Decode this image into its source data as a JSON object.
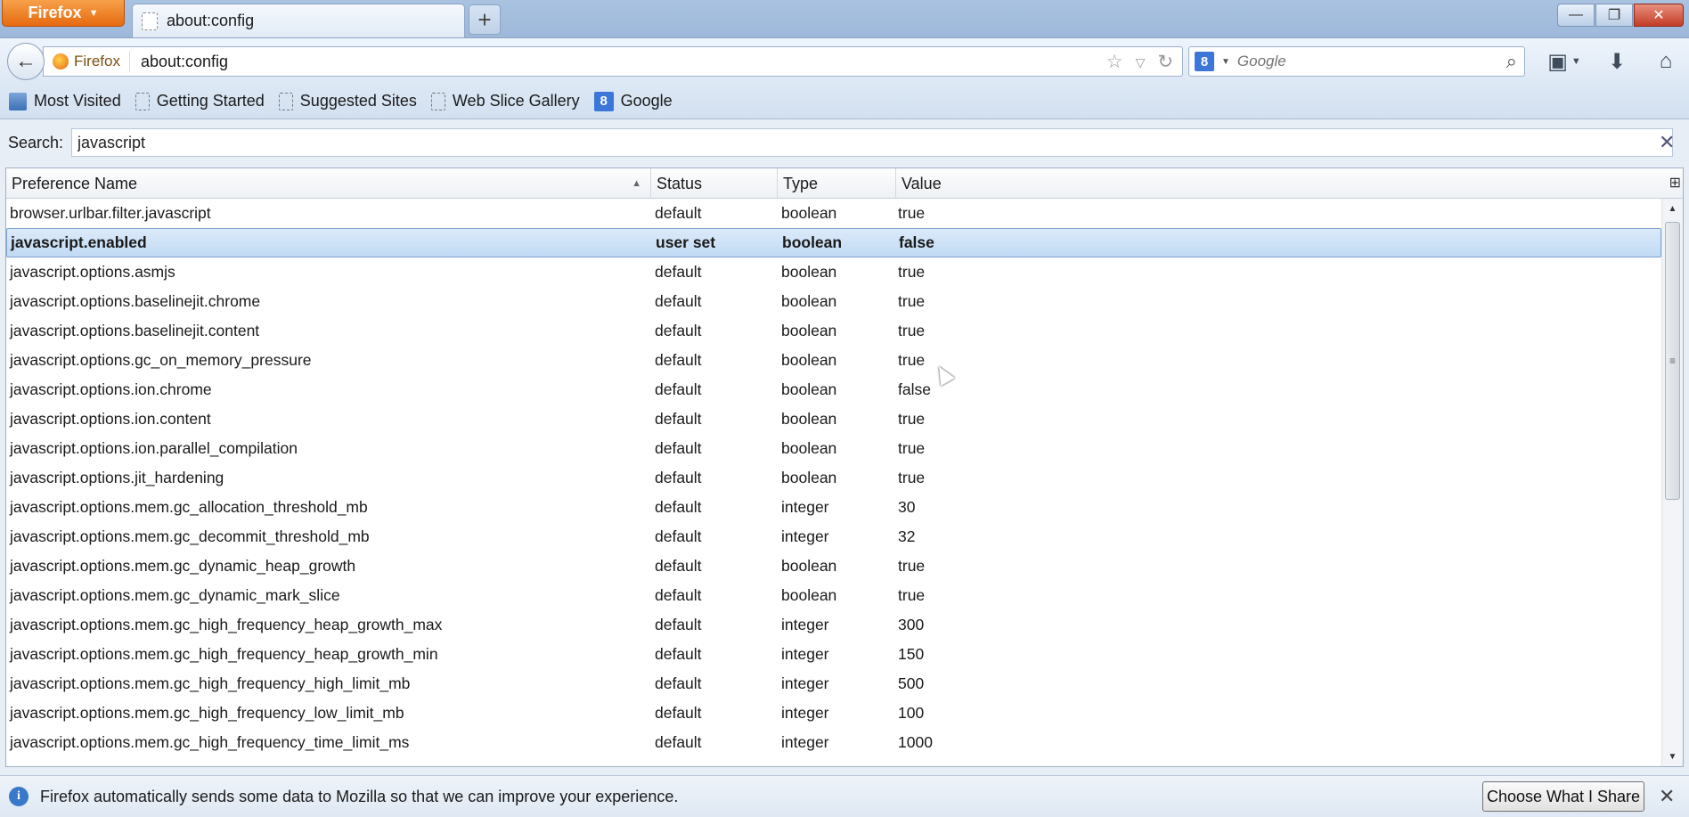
{
  "window": {
    "app_button": "Firefox",
    "tab_title": "about:config",
    "new_tab": "+",
    "minimize": "—",
    "maximize": "❐",
    "close": "✕"
  },
  "nav": {
    "back": "←",
    "identity": "Firefox",
    "url": "about:config",
    "search_engine_badge": "8",
    "search_placeholder": "Google",
    "icons": [
      "bookmark-star-icon",
      "dropdown-icon",
      "reload-icon",
      "search-icon",
      "bookmarks-menu-icon",
      "download-icon",
      "home-icon"
    ]
  },
  "bookmarks": [
    {
      "label": "Most Visited",
      "icon": "most-visited-icon"
    },
    {
      "label": "Getting Started",
      "icon": "page-icon"
    },
    {
      "label": "Suggested Sites",
      "icon": "page-icon"
    },
    {
      "label": "Web Slice Gallery",
      "icon": "page-icon"
    },
    {
      "label": "Google",
      "icon": "google-icon"
    }
  ],
  "filter": {
    "label": "Search:",
    "value": "javascript"
  },
  "table": {
    "columns": [
      "Preference Name",
      "Status",
      "Type",
      "Value"
    ],
    "selected_index": 1,
    "rows": [
      {
        "name": "browser.urlbar.filter.javascript",
        "status": "default",
        "type": "boolean",
        "value": "true"
      },
      {
        "name": "javascript.enabled",
        "status": "user set",
        "type": "boolean",
        "value": "false"
      },
      {
        "name": "javascript.options.asmjs",
        "status": "default",
        "type": "boolean",
        "value": "true"
      },
      {
        "name": "javascript.options.baselinejit.chrome",
        "status": "default",
        "type": "boolean",
        "value": "true"
      },
      {
        "name": "javascript.options.baselinejit.content",
        "status": "default",
        "type": "boolean",
        "value": "true"
      },
      {
        "name": "javascript.options.gc_on_memory_pressure",
        "status": "default",
        "type": "boolean",
        "value": "true"
      },
      {
        "name": "javascript.options.ion.chrome",
        "status": "default",
        "type": "boolean",
        "value": "false"
      },
      {
        "name": "javascript.options.ion.content",
        "status": "default",
        "type": "boolean",
        "value": "true"
      },
      {
        "name": "javascript.options.ion.parallel_compilation",
        "status": "default",
        "type": "boolean",
        "value": "true"
      },
      {
        "name": "javascript.options.jit_hardening",
        "status": "default",
        "type": "boolean",
        "value": "true"
      },
      {
        "name": "javascript.options.mem.gc_allocation_threshold_mb",
        "status": "default",
        "type": "integer",
        "value": "30"
      },
      {
        "name": "javascript.options.mem.gc_decommit_threshold_mb",
        "status": "default",
        "type": "integer",
        "value": "32"
      },
      {
        "name": "javascript.options.mem.gc_dynamic_heap_growth",
        "status": "default",
        "type": "boolean",
        "value": "true"
      },
      {
        "name": "javascript.options.mem.gc_dynamic_mark_slice",
        "status": "default",
        "type": "boolean",
        "value": "true"
      },
      {
        "name": "javascript.options.mem.gc_high_frequency_heap_growth_max",
        "status": "default",
        "type": "integer",
        "value": "300"
      },
      {
        "name": "javascript.options.mem.gc_high_frequency_heap_growth_min",
        "status": "default",
        "type": "integer",
        "value": "150"
      },
      {
        "name": "javascript.options.mem.gc_high_frequency_high_limit_mb",
        "status": "default",
        "type": "integer",
        "value": "500"
      },
      {
        "name": "javascript.options.mem.gc_high_frequency_low_limit_mb",
        "status": "default",
        "type": "integer",
        "value": "100"
      },
      {
        "name": "javascript.options.mem.gc_high_frequency_time_limit_ms",
        "status": "default",
        "type": "integer",
        "value": "1000"
      }
    ]
  },
  "notification": {
    "text": "Firefox automatically sends some data to Mozilla so that we can improve your experience.",
    "button": "Choose What I Share",
    "close": "✕"
  },
  "colors": {
    "firefox_orange": "#e66a10",
    "selection": "#c1daf5",
    "chrome_blue": "#c9d9ec"
  }
}
